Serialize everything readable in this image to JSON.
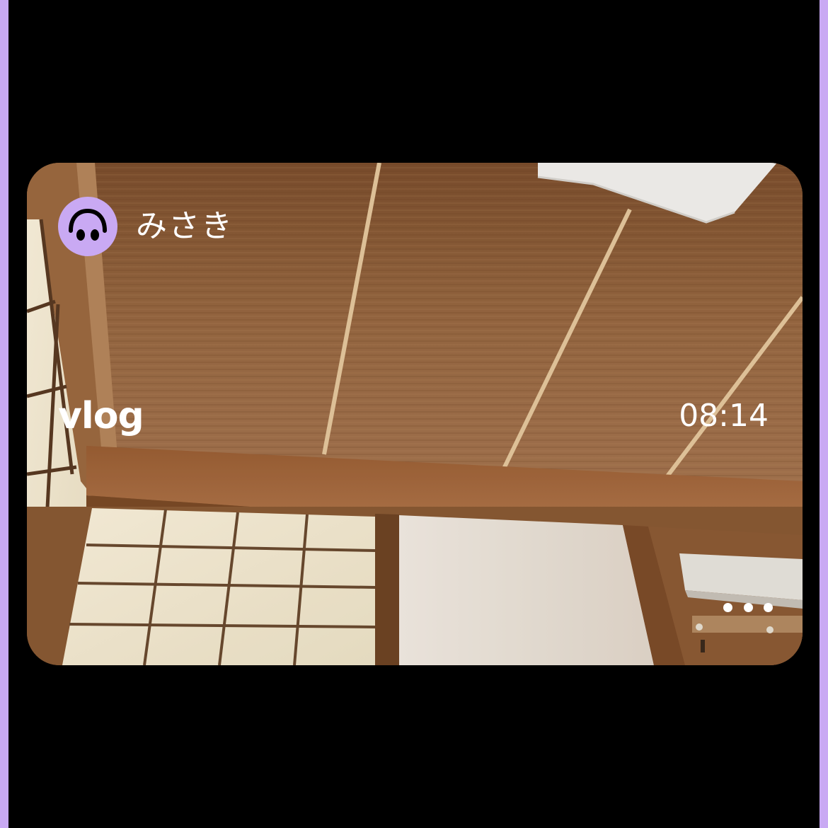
{
  "post": {
    "username": "みさき",
    "title": "vlog",
    "duration": "08:14",
    "avatar_icon": "upside-down-smiley-icon",
    "more_icon": "more-horizontal-icon"
  },
  "colors": {
    "frame_accent": "#c9a9f3",
    "background": "#000000",
    "text": "#ffffff"
  }
}
